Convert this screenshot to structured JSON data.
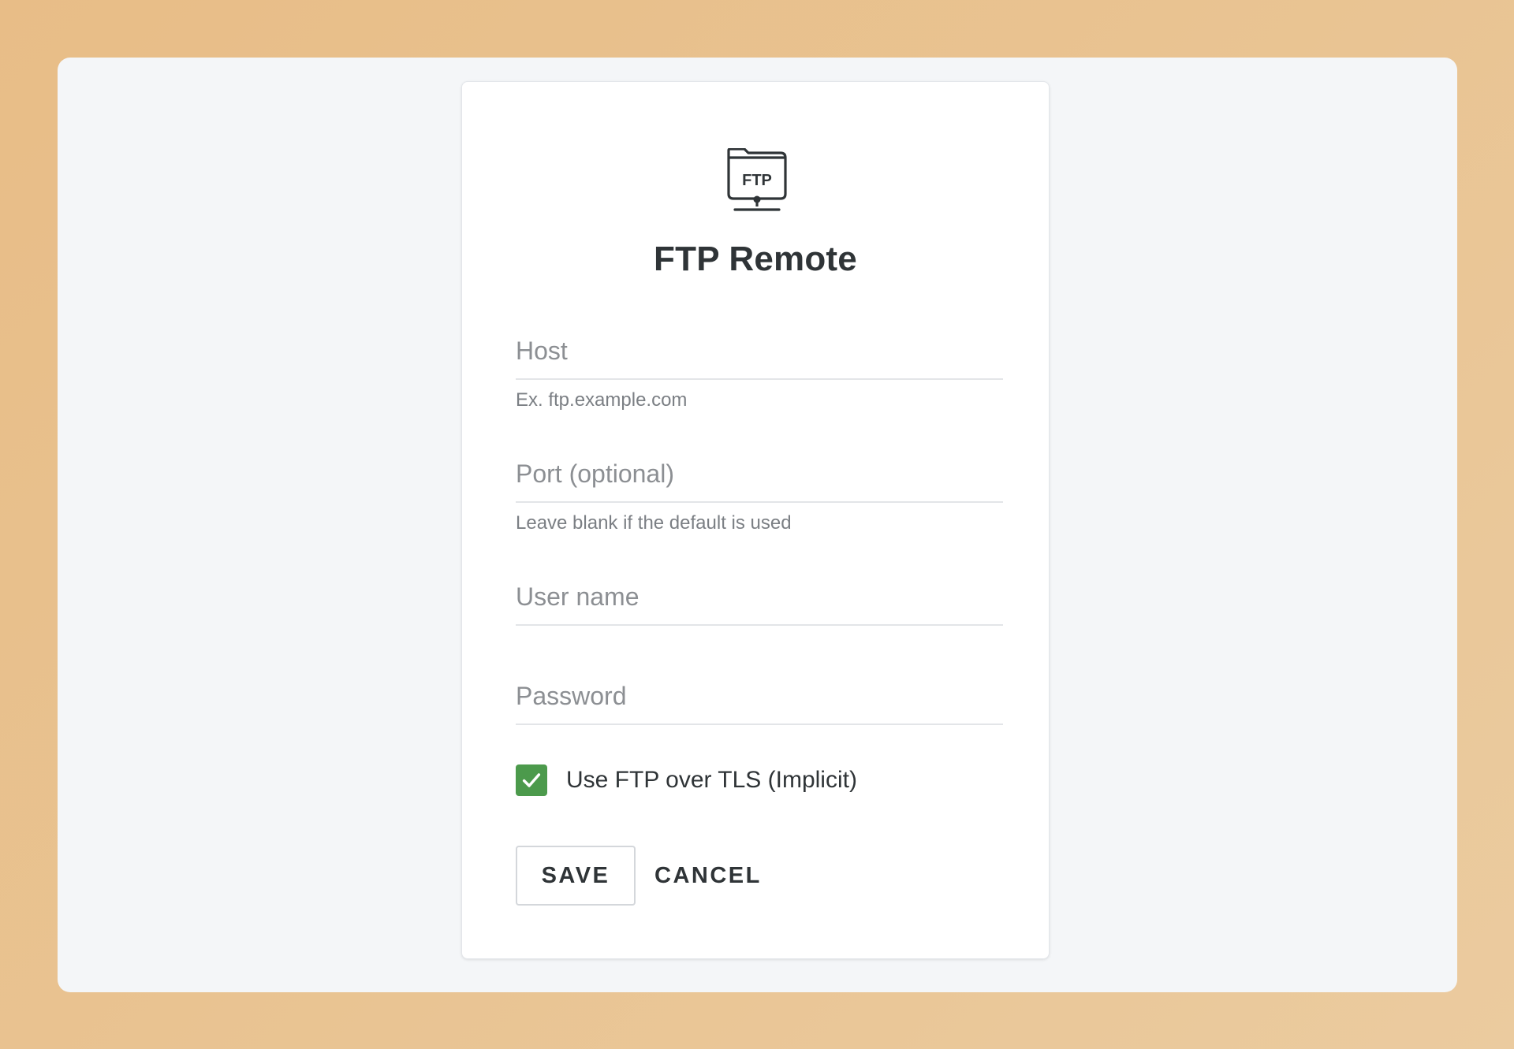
{
  "header": {
    "logo_text": "FTP",
    "title": "FTP Remote"
  },
  "fields": {
    "host": {
      "placeholder": "Host",
      "value": "",
      "hint": "Ex. ftp.example.com"
    },
    "port": {
      "placeholder": "Port (optional)",
      "value": "",
      "hint": "Leave blank if the default is used"
    },
    "username": {
      "placeholder": "User name",
      "value": ""
    },
    "password": {
      "placeholder": "Password",
      "value": ""
    }
  },
  "tls": {
    "label": "Use FTP over TLS (Implicit)",
    "checked": true,
    "color": "#4c9a4c"
  },
  "actions": {
    "save_label": "SAVE",
    "cancel_label": "CANCEL"
  },
  "icons": {
    "logo": "ftp-folder-network-icon",
    "checkbox": "check-icon"
  }
}
